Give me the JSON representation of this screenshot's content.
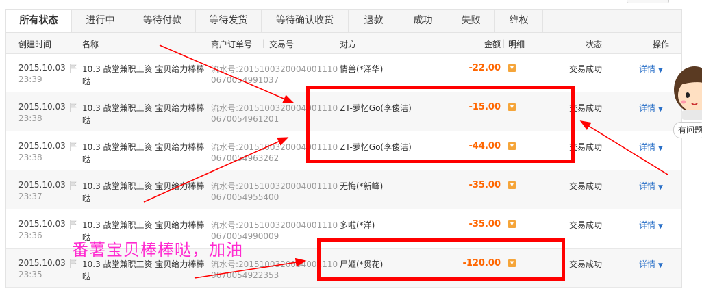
{
  "tabs": [
    {
      "label": "所有状态",
      "active": true
    },
    {
      "label": "进行中"
    },
    {
      "label": "等待付款"
    },
    {
      "label": "等待发货"
    },
    {
      "label": "等待确认收货"
    },
    {
      "label": "退款"
    },
    {
      "label": "成功"
    },
    {
      "label": "失败"
    },
    {
      "label": "维权"
    }
  ],
  "columns": {
    "created": "创建时间",
    "name": "名称",
    "order_no": "商户订单号",
    "sep": "|",
    "trade_no": "交易号",
    "party": "对方",
    "amount": "金额",
    "detail": "明细",
    "status": "状态",
    "action": "操作"
  },
  "rows": [
    {
      "date": "2015.10.03",
      "time": "23:39",
      "name1": "10.3 战堂兼职工资 宝贝给力棒棒",
      "name2": "哒",
      "serial1": "流水号:2015100320004001110",
      "serial2": "0670054991037",
      "party": "情兽(*泽华)",
      "amount": "-22.00",
      "status": "交易成功",
      "detail_link": "详情"
    },
    {
      "date": "2015.10.03",
      "time": "23:38",
      "name1": "10.3 战堂兼职工资 宝贝给力棒棒",
      "name2": "哒",
      "serial1": "流水号:2015100320004001110",
      "serial2": "0670054961201",
      "party": "ZT-萝忆Go(李俊洁)",
      "amount": "-15.00",
      "status": "交易成功",
      "detail_link": "详情"
    },
    {
      "date": "2015.10.03",
      "time": "23:38",
      "name1": "10.3 战堂兼职工资 宝贝给力棒棒",
      "name2": "哒",
      "serial1": "流水号:2015100320004001110",
      "serial2": "0670054963262",
      "party": "ZT-萝忆Go(李俊洁)",
      "amount": "-44.00",
      "status": "交易成功",
      "detail_link": "详情"
    },
    {
      "date": "2015.10.03",
      "time": "23:37",
      "name1": "10.3 战堂兼职工资 宝贝给力棒棒",
      "name2": "哒",
      "serial1": "流水号:2015100320004001110",
      "serial2": "0670054955400",
      "party": "无悔(*新峰)",
      "amount": "-35.00",
      "status": "交易成功",
      "detail_link": "详情"
    },
    {
      "date": "2015.10.03",
      "time": "23:36",
      "name1": "10.3 战堂兼职工资 宝贝给力棒棒",
      "name2": "哒",
      "serial1": "流水号:2015100320004001110",
      "serial2": "0670054990009",
      "party": "多啦(*洋)",
      "amount": "-35.00",
      "status": "交易成功",
      "detail_link": "详情"
    },
    {
      "date": "2015.10.03",
      "time": "23:35",
      "name1": "10.3 战堂兼职工资 宝贝给力棒棒",
      "name2": "哒",
      "serial1": "流水号:2015100320004001110",
      "serial2": "0670054922353",
      "party": "尸姬(*贯花)",
      "amount": "-120.00",
      "status": "交易成功",
      "detail_link": "详情"
    }
  ],
  "overlay_text": "番薯宝贝棒棒哒，加油",
  "helper_label": "有问题",
  "colors": {
    "amount": "#ff6600",
    "link": "#2a70c8",
    "annotation": "#ff0000",
    "overlay_text": "#ff2ad0"
  }
}
